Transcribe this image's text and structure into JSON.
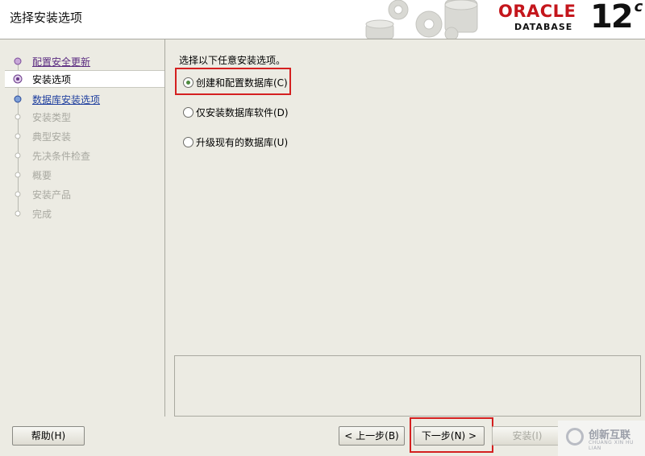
{
  "header": {
    "title": "选择安装选项",
    "brand_word": "ORACLE",
    "brand_sub": "DATABASE",
    "version": "12",
    "version_suffix": "c"
  },
  "steps": [
    {
      "label": "配置安全更新",
      "state": "link"
    },
    {
      "label": "安装选项",
      "state": "active"
    },
    {
      "label": "数据库安装选项",
      "state": "link"
    },
    {
      "label": "安装类型",
      "state": "disabled"
    },
    {
      "label": "典型安装",
      "state": "disabled"
    },
    {
      "label": "先决条件检查",
      "state": "disabled"
    },
    {
      "label": "概要",
      "state": "disabled"
    },
    {
      "label": "安装产品",
      "state": "disabled"
    },
    {
      "label": "完成",
      "state": "disabled"
    }
  ],
  "main": {
    "instruction": "选择以下任意安装选项。",
    "options": [
      {
        "label": "创建和配置数据库(C)",
        "checked": true
      },
      {
        "label": "仅安装数据库软件(D)",
        "checked": false
      },
      {
        "label": "升级现有的数据库(U)",
        "checked": false
      }
    ]
  },
  "footer": {
    "help": "帮助(H)",
    "back": "< 上一步(B)",
    "next": "下一步(N) >",
    "install": "安装(I)"
  },
  "watermark": {
    "text": "创新互联",
    "sub": "CHUANG XIN HU LIAN"
  },
  "colors": {
    "accent_red": "#d42020",
    "brand_red": "#c4161c",
    "radio_green": "#4e8a3e"
  }
}
